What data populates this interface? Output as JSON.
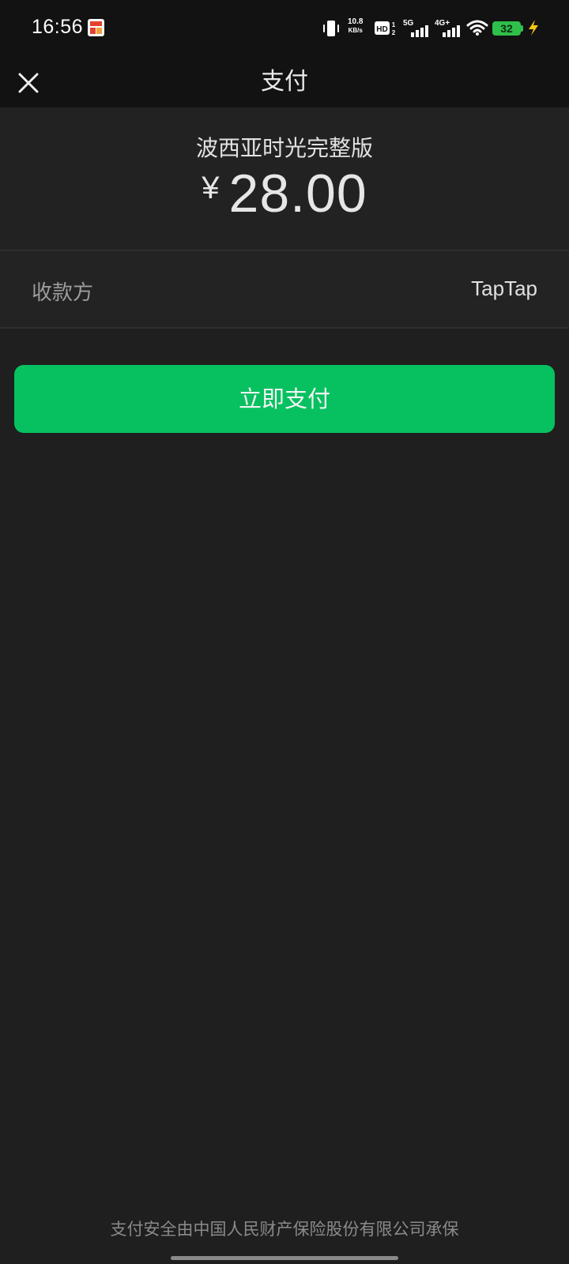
{
  "status_bar": {
    "time": "16:56",
    "net_speed_value": "10.8",
    "net_speed_unit": "KB/s",
    "hd_label": "HD",
    "sim1_label": "1",
    "sim2_label": "2",
    "net_5g": "5G",
    "net_4g": "4G+",
    "battery": "32",
    "battery_color": "#2fbf4b",
    "icons": [
      "app-notification-icon",
      "vibrate-icon",
      "hd-icon",
      "signal-5g-icon",
      "signal-4g-icon",
      "wifi-icon",
      "battery-icon",
      "charging-bolt-icon"
    ]
  },
  "header": {
    "title": "支付",
    "close_icon": "close-icon"
  },
  "product": {
    "name": "波西亚时光完整版",
    "currency_symbol": "¥",
    "amount": "28.00"
  },
  "payee": {
    "label": "收款方",
    "value": "TapTap"
  },
  "actions": {
    "pay_label": "立即支付",
    "pay_color": "#07c160"
  },
  "footer": {
    "text": "支付安全由中国人民财产保险股份有限公司承保"
  }
}
